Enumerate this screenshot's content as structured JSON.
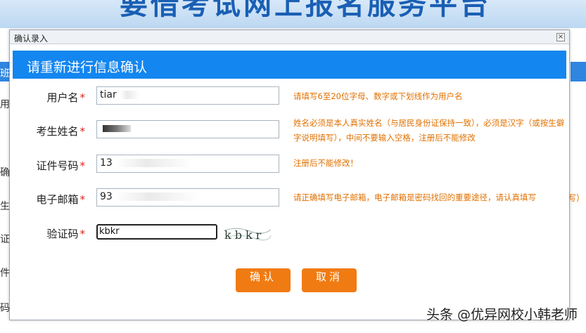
{
  "background": {
    "banner_text": "要借考试网上报名服务平台",
    "left_glyphs": [
      "班",
      "用",
      "确",
      "生",
      "证",
      "件",
      "码"
    ],
    "right_glyph": "写）"
  },
  "dialog": {
    "title": "确认录入",
    "close_label": "☒",
    "banner": "请重新进行信息确认",
    "fields": {
      "username": {
        "label": "用户名",
        "required": "*",
        "value": "tiar",
        "hint": "请填写6至20位字母、数字或下划线作为用户名"
      },
      "realname": {
        "label": "考生姓名",
        "required": "*",
        "value": "",
        "hint": "姓名必须是本人真实姓名（与居民身份证保持一致），必须是汉字（或按生僻字说明填写），中间不要输入空格，注册后不能修改"
      },
      "idnumber": {
        "label": "证件号码",
        "required": "*",
        "value": "13",
        "hint": "注册后不能修改！"
      },
      "email": {
        "label": "电子邮箱",
        "required": "*",
        "value": "93",
        "hint": "请正确填写电子邮箱，电子邮箱是密码找回的重要途径，请认真填写"
      },
      "captcha": {
        "label": "验证码",
        "required": "*",
        "value": "kbkr",
        "image_text": "kbkr"
      }
    },
    "confirm_label": "确认",
    "cancel_label": "取消"
  },
  "watermark": "头条 @优异网校小韩老师",
  "colors": {
    "banner_blue": "#1386ef",
    "button_orange": "#f07b12",
    "hint_orange": "#e07000",
    "required_red": "#e02020"
  }
}
